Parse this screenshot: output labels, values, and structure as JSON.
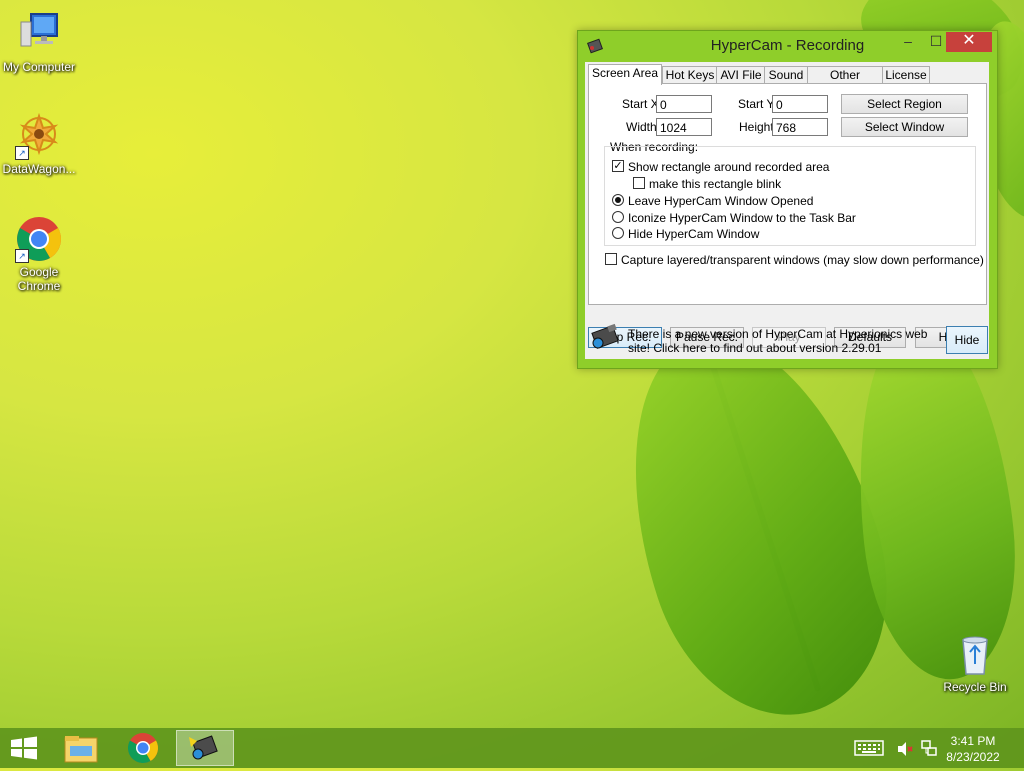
{
  "desktop": {
    "icons": [
      {
        "label": "My Computer"
      },
      {
        "label": "DataWagon..."
      },
      {
        "label": "Google Chrome"
      },
      {
        "label": "Recycle Bin"
      }
    ]
  },
  "window": {
    "title": "HyperCam - Recording",
    "tabs": [
      "Screen Area",
      "Hot Keys",
      "AVI File",
      "Sound",
      "Other Options",
      "License"
    ],
    "active_tab": "Screen Area",
    "fields": {
      "start_x_label": "Start X",
      "start_x": "0",
      "start_y_label": "Start Y",
      "start_y": "0",
      "width_label": "Width",
      "width": "1024",
      "height_label": "Height",
      "height": "768"
    },
    "buttons": {
      "select_region": "Select Region",
      "select_window": "Select Window",
      "stop": "Stop Rec.",
      "pause": "Pause Rec.",
      "play": "Play",
      "defaults": "Defaults",
      "help": "Help",
      "hide": "Hide"
    },
    "when_recording": {
      "label": "When recording:",
      "show_rect": "Show rectangle around recorded area",
      "blink": "make this rectangle blink",
      "leave_open": "Leave HyperCam Window Opened",
      "iconize": "Iconize HyperCam Window to the Task Bar",
      "hide_window": "Hide HyperCam Window"
    },
    "capture_layered": "Capture layered/transparent windows (may slow down performance)",
    "notice": "There is a new version of HyperCam at Hyperionics web site! Click here to find out about version 2.29.01"
  },
  "taskbar": {
    "time": "3:41 PM",
    "date": "8/23/2022"
  },
  "colors": {
    "taskbar": "#60961c",
    "close_button": "#c7413c",
    "window_frame": "#8fce2a"
  }
}
